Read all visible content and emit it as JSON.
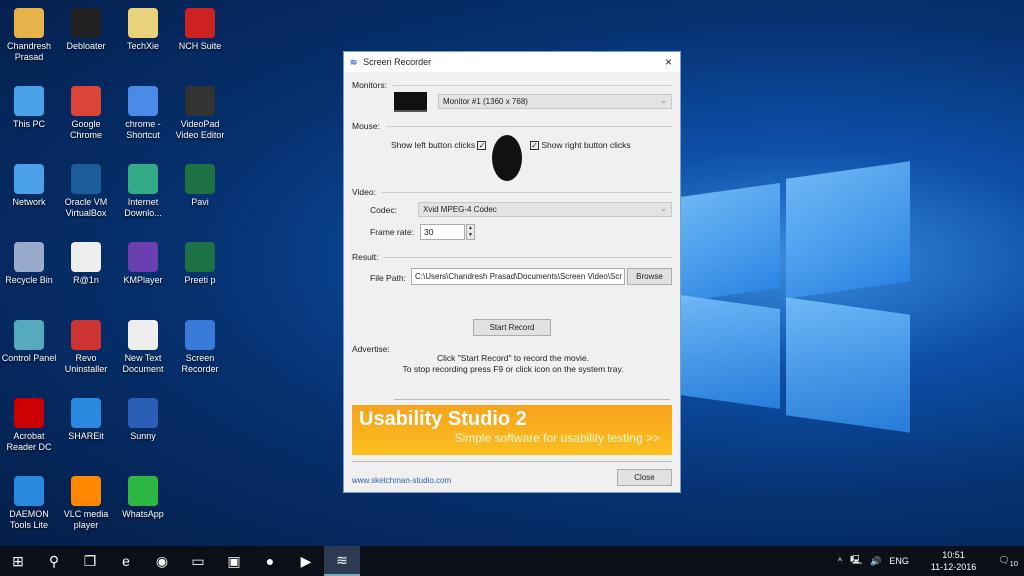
{
  "desktop": {
    "icons": [
      [
        "Chandresh Prasad",
        "#e8b24a"
      ],
      [
        "This PC",
        "#4aa3e8"
      ],
      [
        "Network",
        "#4aa3e8"
      ],
      [
        "Recycle Bin",
        "#9ac"
      ],
      [
        "Control Panel",
        "#5ab"
      ],
      [
        "Acrobat Reader DC",
        "#c00"
      ],
      [
        "DAEMON Tools Lite",
        "#2a8ae0"
      ],
      [
        "Debloater",
        "#222"
      ],
      [
        "Google Chrome",
        "#db4437"
      ],
      [
        "Oracle VM VirtualBox",
        "#1b5e9a"
      ],
      [
        "R@1n",
        "#eee"
      ],
      [
        "Revo Uninstaller",
        "#c33"
      ],
      [
        "SHAREit",
        "#2a8ae0"
      ],
      [
        "VLC media player",
        "#f80"
      ],
      [
        "TechXie",
        "#e8d27a"
      ],
      [
        "chrome - Shortcut",
        "#4a8be8"
      ],
      [
        "Internet Downlo...",
        "#3a8"
      ],
      [
        "KMPlayer",
        "#6a3fb0"
      ],
      [
        "New Text Document",
        "#eee"
      ],
      [
        "Sunny",
        "#2b5fb5"
      ],
      [
        "WhatsApp",
        "#2bb741"
      ],
      [
        "NCH Suite",
        "#c22"
      ],
      [
        "VideoPad Video Editor",
        "#333"
      ],
      [
        "Pavi",
        "#1e7145"
      ],
      [
        "Preeti p",
        "#1e7145"
      ],
      [
        "Screen Recorder",
        "#3a7ad8"
      ]
    ]
  },
  "dialog": {
    "title": "Screen Recorder",
    "close_icon": "×",
    "monitors_label": "Monitors:",
    "monitor_value": "Monitor #1 (1360 x 768)",
    "mouse_label": "Mouse:",
    "left_clicks": "Show left button clicks",
    "right_clicks": "Show right button clicks",
    "check": "✓",
    "video_label": "Video:",
    "codec_label": "Codec:",
    "codec_value": "Xvid MPEG-4 Codec",
    "frame_rate_label": "Frame rate:",
    "frame_rate_value": "30",
    "result_label": "Result:",
    "file_path_label": "File Path:",
    "file_path_value": "C:\\Users\\Chandresh Prasad\\Documents\\Screen Video\\Scr",
    "browse": "Browse",
    "start_record": "Start Record",
    "advertise_label": "Advertise:",
    "hint1": "Click \"Start Record\" to record the movie.",
    "hint2": "To stop recording press F9 or click icon on the system tray.",
    "ad_title": "Usability Studio 2",
    "ad_sub": "Simple software for usability testing >>",
    "link": "www.sketchman-studio.com",
    "close_button": "Close"
  },
  "taskbar": {
    "items": [
      "⊞",
      "⚲",
      "❐",
      "e",
      "◉",
      "▭",
      "▣",
      "●",
      "▶",
      "≋"
    ],
    "tray": {
      "chevron": "^",
      "network": "🖳",
      "volume": "🔊",
      "lang": "ENG",
      "time": "10:51",
      "date": "11-12-2016",
      "notif": "10"
    }
  }
}
